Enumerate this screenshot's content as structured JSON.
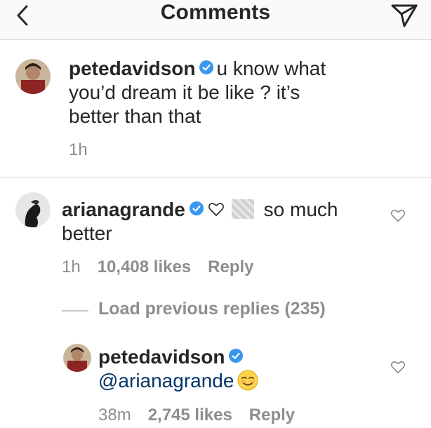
{
  "header": {
    "title": "Comments"
  },
  "comment1": {
    "username": "petedavidson",
    "text_line1": "u know what",
    "text_line2": "you’d dream it be like ? it’s",
    "text_line3": "better than that",
    "time": "1h"
  },
  "comment2": {
    "username": "arianagrande",
    "text_after": "so much",
    "text_line2": "better",
    "time": "1h",
    "likes": "10,408 likes",
    "reply": "Reply",
    "load_previous": "Load previous replies (235)"
  },
  "reply1": {
    "username": "petedavidson",
    "mention": "@arianagrande",
    "time": "38m",
    "likes": "2,745 likes",
    "reply": "Reply"
  },
  "icons": {
    "back": "chevron-left-icon",
    "share": "paper-plane-icon",
    "verified": "verified-badge-icon",
    "like": "heart-outline-icon"
  },
  "colors": {
    "verified": "#3897f0",
    "meta": "#8e8e8e",
    "text": "#262626",
    "divider": "#dbdbdb"
  }
}
